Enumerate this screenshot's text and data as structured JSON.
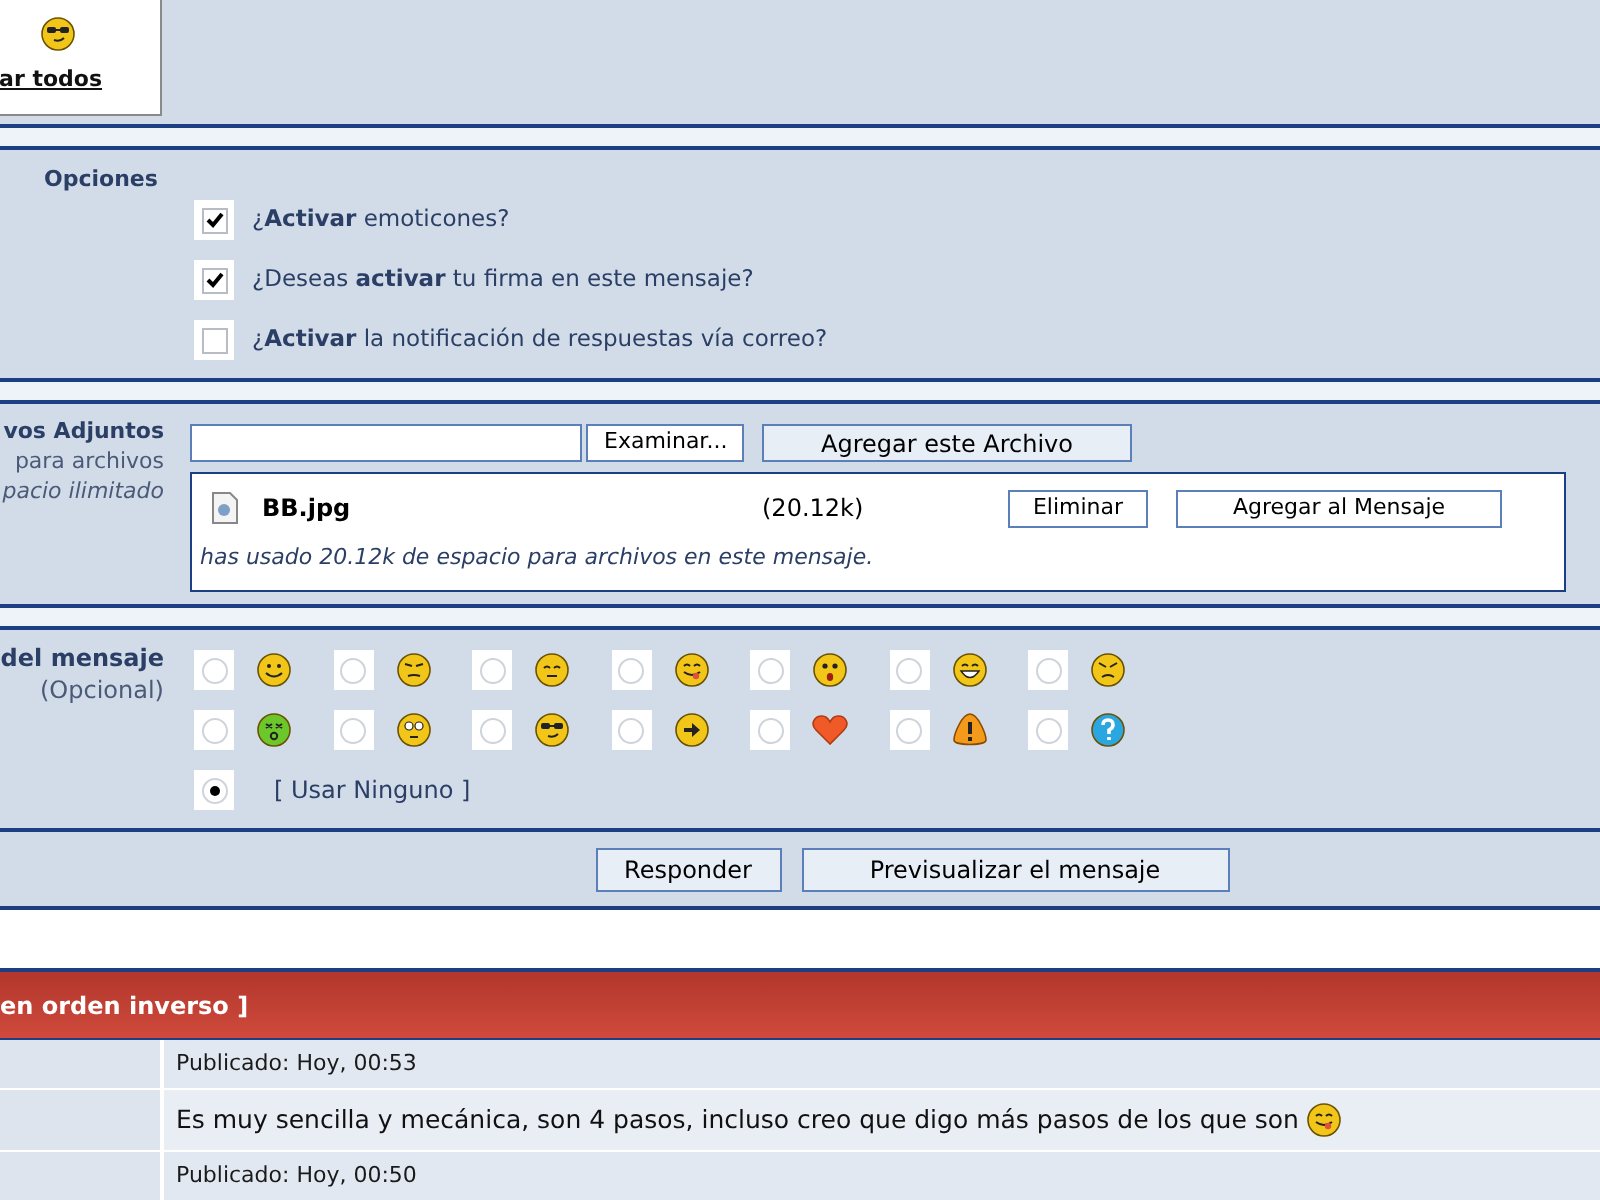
{
  "top_panel": {
    "link": "ar todos"
  },
  "options": {
    "label": "Opciones",
    "items": [
      {
        "text": "¿**Activar** emoticones?",
        "checked": true
      },
      {
        "text": "¿Deseas **activar** tu firma en este mensaje?",
        "checked": true
      },
      {
        "text": "¿**Activar** la notificación de respuestas vía correo?",
        "checked": false
      }
    ]
  },
  "attachments": {
    "title": "vos Adjuntos",
    "subtitle": "para archivos",
    "quota": "pacio ilimitado",
    "browse_button": "Examinar...",
    "add_button": "Agregar este Archivo",
    "file": {
      "name": "BB.jpg",
      "size": "(20.12k)",
      "buttons": [
        "Eliminar",
        "Agregar al Mensaje"
      ]
    },
    "usage": "has usado 20.12k de espacio para archivos en este mensaje."
  },
  "post_icon": {
    "label": "del mensaje",
    "sublabel": "(Opcional)",
    "icons": [
      {
        "selected": false
      },
      {
        "selected": false
      },
      {
        "selected": false
      },
      {
        "selected": false
      },
      {
        "selected": false
      },
      {
        "selected": false
      },
      {
        "selected": false
      },
      {
        "selected": false
      },
      {
        "selected": false
      },
      {
        "selected": false
      },
      {
        "selected": false
      },
      {
        "selected": false
      },
      {
        "selected": false
      },
      {
        "selected": false
      }
    ],
    "none_option": {
      "label": "[ Usar Ninguno ]",
      "selected": true
    }
  },
  "actions": [
    "Responder",
    "Previsualizar el mensaje"
  ],
  "review": {
    "title": "en orden inverso ]",
    "posts": [
      {
        "meta": "Publicado: Hoy, 00:53",
        "body": "Es muy sencilla y mecánica, son 4 pasos, incluso creo que digo más pasos de los que son"
      },
      {
        "meta": "Publicado: Hoy, 00:50"
      }
    ]
  }
}
